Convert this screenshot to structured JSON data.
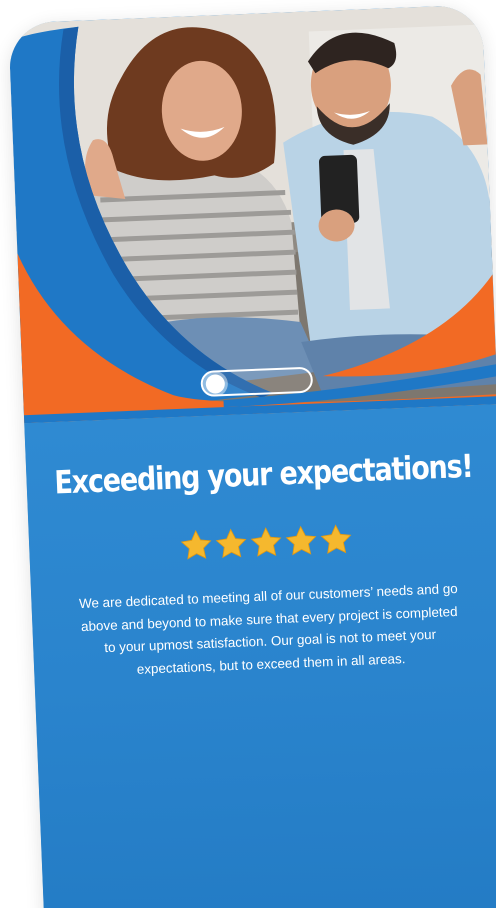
{
  "hero": {
    "image_icon": "couple-celebrating-photo",
    "colors": {
      "blue": "#1f78c6",
      "orange": "#f26a24",
      "dark_blue": "#1b5fa8"
    }
  },
  "content": {
    "headline": "Exceeding your expectations!",
    "rating": 5,
    "star_icon": "star-icon",
    "star_color": "#f5b82e",
    "description": "We are dedicated to meeting all of our customers’ needs and go above and beyond to make sure that every project is completed to your upmost satisfaction. Our goal is not to meet your expectations, but to exceed them in all areas."
  },
  "slider": {
    "active_index": 0
  },
  "theme": {
    "panel_blue": "#2a86cf",
    "text_white": "#ffffff"
  }
}
